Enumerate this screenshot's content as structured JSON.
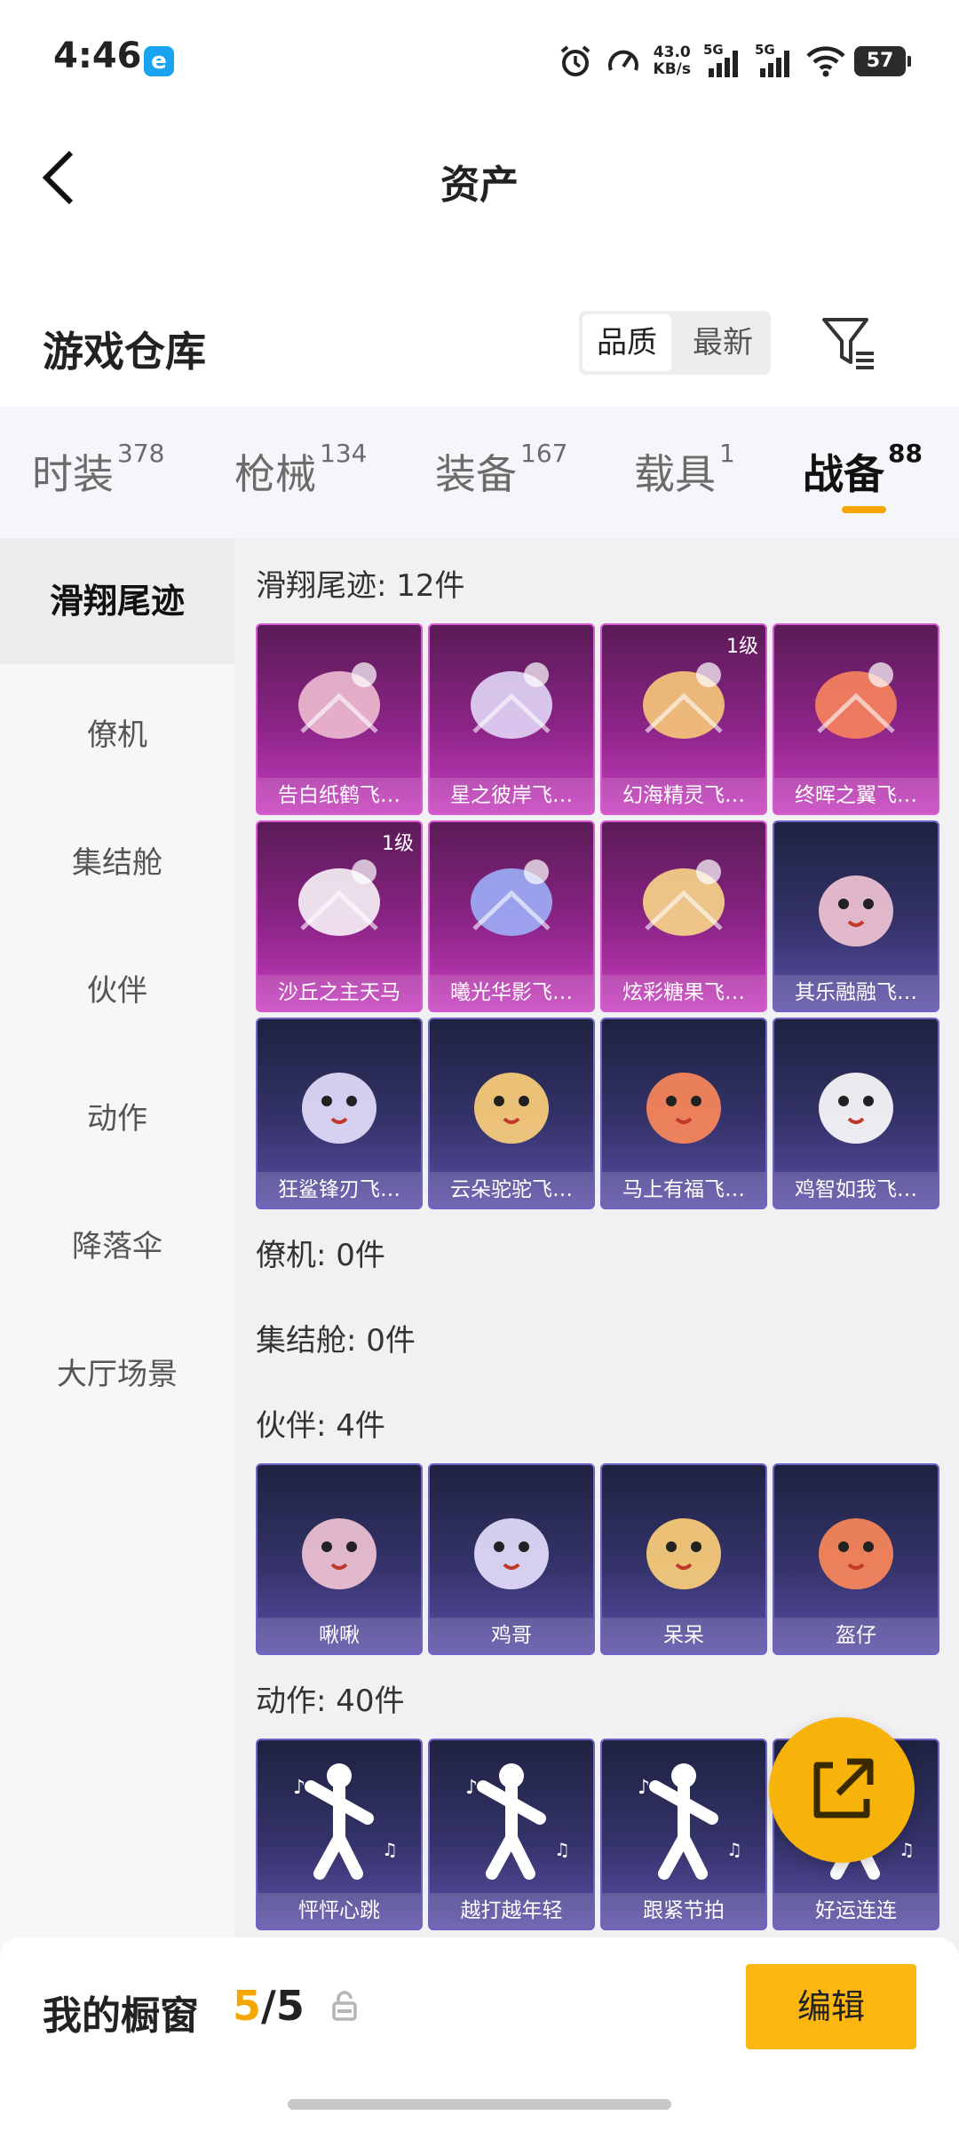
{
  "status": {
    "time": "4:46",
    "app_icon_letter": "e",
    "net_speed_value": "43.0",
    "net_speed_unit": "KB/s",
    "signal1_label": "5G",
    "signal2_label": "5G",
    "battery": "57"
  },
  "header": {
    "title": "资产"
  },
  "warehouse": {
    "title": "游戏仓库",
    "sort_options": [
      "品质",
      "最新"
    ],
    "active_sort": "品质"
  },
  "tabs": [
    {
      "label": "时装",
      "count": "378"
    },
    {
      "label": "枪械",
      "count": "134"
    },
    {
      "label": "装备",
      "count": "167"
    },
    {
      "label": "载具",
      "count": "1"
    },
    {
      "label": "战备",
      "count": "88"
    }
  ],
  "active_tab": "战备",
  "sidebar": [
    {
      "label": "滑翔尾迹"
    },
    {
      "label": "僚机"
    },
    {
      "label": "集结舱"
    },
    {
      "label": "伙伴"
    },
    {
      "label": "动作"
    },
    {
      "label": "降落伞"
    },
    {
      "label": "大厅场景"
    }
  ],
  "sections": {
    "glide": {
      "title": "滑翔尾迹: 12件",
      "items": [
        {
          "label": "告白纸鹤飞…",
          "rarity": "pink",
          "level": ""
        },
        {
          "label": "星之彼岸飞…",
          "rarity": "pink",
          "level": ""
        },
        {
          "label": "幻海精灵飞…",
          "rarity": "pink",
          "level": "1级"
        },
        {
          "label": "终晖之翼飞…",
          "rarity": "pink",
          "level": ""
        },
        {
          "label": "沙丘之主天马",
          "rarity": "pink",
          "level": "1级"
        },
        {
          "label": "曦光华影飞…",
          "rarity": "pink",
          "level": ""
        },
        {
          "label": "炫彩糖果飞…",
          "rarity": "pink",
          "level": ""
        },
        {
          "label": "其乐融融飞…",
          "rarity": "blue",
          "level": ""
        },
        {
          "label": "狂鲨锋刃飞…",
          "rarity": "blue",
          "level": ""
        },
        {
          "label": "云朵驼驼飞…",
          "rarity": "blue",
          "level": ""
        },
        {
          "label": "马上有福飞…",
          "rarity": "blue",
          "level": ""
        },
        {
          "label": "鸡智如我飞…",
          "rarity": "blue",
          "level": ""
        }
      ]
    },
    "wingman": {
      "title": "僚机: 0件"
    },
    "pod": {
      "title": "集结舱: 0件"
    },
    "partner": {
      "title": "伙伴: 4件",
      "items": [
        {
          "label": "啾啾",
          "rarity": "blue"
        },
        {
          "label": "鸡哥",
          "rarity": "blue"
        },
        {
          "label": "呆呆",
          "rarity": "blue"
        },
        {
          "label": "盔仔",
          "rarity": "blue"
        }
      ]
    },
    "emote": {
      "title": "动作: 40件",
      "items": [
        {
          "label": "怦怦心跳",
          "rarity": "blue"
        },
        {
          "label": "越打越年轻",
          "rarity": "blue"
        },
        {
          "label": "跟紧节拍",
          "rarity": "blue"
        },
        {
          "label": "好运连连",
          "rarity": "blue"
        }
      ]
    }
  },
  "bottom": {
    "showcase_label": "我的橱窗",
    "showcase_current": "5",
    "showcase_sep": "/",
    "showcase_total": "5",
    "edit_label": "编辑"
  }
}
